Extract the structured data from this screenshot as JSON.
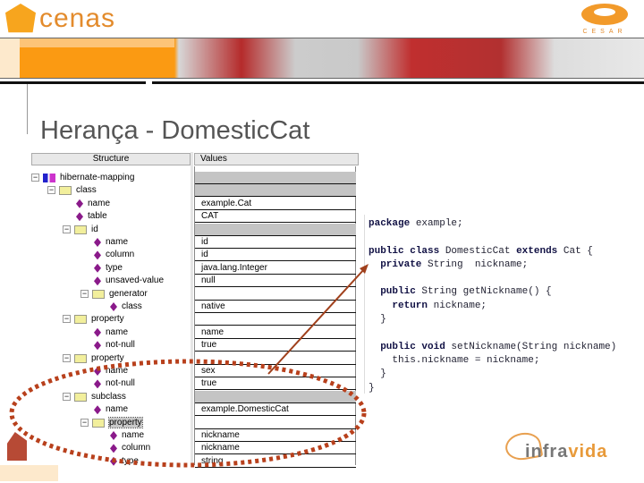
{
  "header": {
    "logo_text": "cenas",
    "right_logo_text": "CESAR"
  },
  "slide": {
    "title": "Herança - DomesticCat"
  },
  "tree": {
    "structure_header": "Structure",
    "values_header": "Values",
    "rows": [
      {
        "label": "hibernate-mapping",
        "kind": "root",
        "level": 0,
        "value": "",
        "gray": true
      },
      {
        "label": "class",
        "kind": "folder",
        "level": 1,
        "value": "",
        "gray": true
      },
      {
        "label": "name",
        "kind": "attr",
        "level": 2,
        "value": "example.Cat"
      },
      {
        "label": "table",
        "kind": "attr",
        "level": 2,
        "value": "CAT"
      },
      {
        "label": "id",
        "kind": "folder",
        "level": 2,
        "value": "",
        "gray": true
      },
      {
        "label": "name",
        "kind": "attr",
        "level": 3,
        "value": "id"
      },
      {
        "label": "column",
        "kind": "attr",
        "level": 3,
        "value": "id"
      },
      {
        "label": "type",
        "kind": "attr",
        "level": 3,
        "value": "java.lang.Integer"
      },
      {
        "label": "unsaved-value",
        "kind": "attr",
        "level": 3,
        "value": "null"
      },
      {
        "label": "generator",
        "kind": "folder",
        "level": 3,
        "value": ""
      },
      {
        "label": "class",
        "kind": "attr",
        "level": 4,
        "value": "native"
      },
      {
        "label": "property",
        "kind": "folder",
        "level": 2,
        "value": ""
      },
      {
        "label": "name",
        "kind": "attr",
        "level": 3,
        "value": "name"
      },
      {
        "label": "not-null",
        "kind": "attr",
        "level": 3,
        "value": "true"
      },
      {
        "label": "property",
        "kind": "folder",
        "level": 2,
        "value": ""
      },
      {
        "label": "name",
        "kind": "attr",
        "level": 3,
        "value": "sex"
      },
      {
        "label": "not-null",
        "kind": "attr",
        "level": 3,
        "value": "true"
      },
      {
        "label": "subclass",
        "kind": "folder",
        "level": 2,
        "value": "",
        "gray": true
      },
      {
        "label": "name",
        "kind": "attr",
        "level": 3,
        "value": "example.DomesticCat"
      },
      {
        "label": "property",
        "kind": "folder",
        "level": 3,
        "value": "",
        "selected": true
      },
      {
        "label": "name",
        "kind": "attr",
        "level": 4,
        "value": "nickname"
      },
      {
        "label": "column",
        "kind": "attr",
        "level": 4,
        "value": "nickname"
      },
      {
        "label": "type",
        "kind": "attr",
        "level": 4,
        "value": "string"
      }
    ]
  },
  "code": {
    "lines": [
      "package example;",
      "",
      "public class DomesticCat extends Cat {",
      "  private String  nickname;",
      "",
      "  public String getNickname() {",
      "    return nickname;",
      "  }",
      "",
      "  public void setNickname(String nickname)",
      "    this.nickname = nickname;",
      "  }",
      "}"
    ]
  },
  "footer": {
    "logo_text_a": "infra",
    "logo_text_b": "vida"
  },
  "colors": {
    "accent": "#fb9a12",
    "annotation": "#b8401c"
  }
}
